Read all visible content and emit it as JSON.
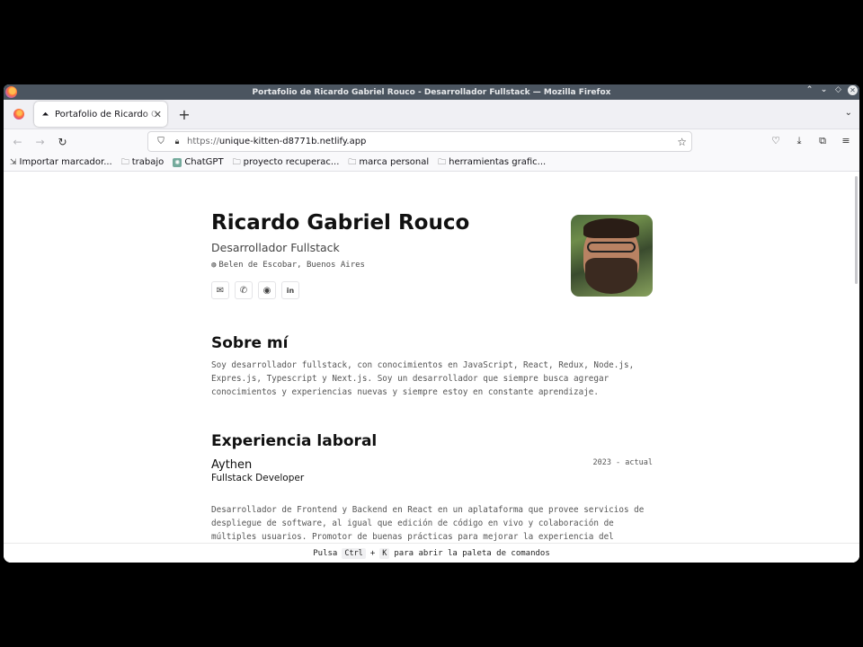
{
  "window": {
    "title": "Portafolio de Ricardo Gabriel Rouco - Desarrollador Fullstack — Mozilla Firefox"
  },
  "tabs": [
    {
      "label": "Portafolio de Ricardo Gabriel Rouco - Desarrollador Fullstack",
      "active": true
    }
  ],
  "urlbar": {
    "protocol": "https://",
    "host": "unique-kitten-d8771b.netlify.app"
  },
  "bookmarks": [
    {
      "label": "Importar marcador...",
      "icon": "import-icon"
    },
    {
      "label": "trabajo",
      "icon": "folder-icon"
    },
    {
      "label": "ChatGPT",
      "icon": "chatgpt-icon"
    },
    {
      "label": "proyecto recuperac...",
      "icon": "folder-icon"
    },
    {
      "label": "marca personal",
      "icon": "folder-icon"
    },
    {
      "label": "herramientas grafic...",
      "icon": "folder-icon"
    }
  ],
  "profile": {
    "name": "Ricardo Gabriel Rouco",
    "role": "Desarrollador Fullstack",
    "location": "Belen de Escobar, Buenos Aires",
    "contacts": [
      "mail-icon",
      "phone-icon",
      "github-icon",
      "linkedin-icon"
    ]
  },
  "about": {
    "title": "Sobre mí",
    "text": "Soy desarrollador fullstack, con conocimientos en JavaScript, React, Redux, Node.js, Expres.js, Typescript y Next.js. Soy un desarrollador que siempre busca agregar conocimientos y experiencias nuevas y siempre estoy en constante aprendizaje."
  },
  "experience": {
    "title": "Experiencia laboral",
    "jobs": [
      {
        "company": "Aythen",
        "position": "Fullstack Developer",
        "dates": "2023 - actual",
        "description": "Desarrollador de Frontend y Backend en React en un aplataforma que provee servicios de despliegue de software, al igual que edición de código en vivo y colaboración de múltiples usuarios. Promotor de buenas prácticas para mejorar la experiencia del"
      }
    ]
  },
  "command_hint": {
    "prefix": "Pulsa",
    "key1": "Ctrl",
    "plus": "+",
    "key2": "K",
    "suffix": "para abrir la paleta de comandos"
  }
}
